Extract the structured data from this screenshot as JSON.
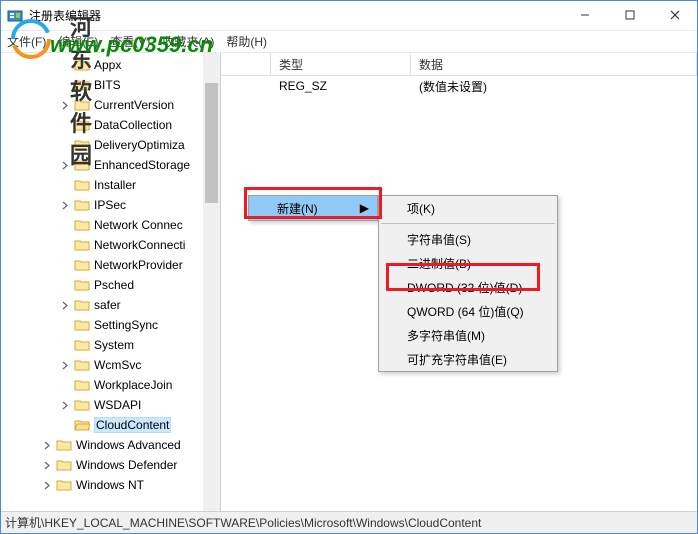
{
  "window": {
    "title": "注册表编辑器"
  },
  "menubar": {
    "file": "文件(F)",
    "edit": "编辑(E)",
    "view": "查看(V)",
    "fav": "收藏夹(A)",
    "help": "帮助(H)"
  },
  "tree": {
    "items": [
      {
        "label": "Appx",
        "indent": 2,
        "exp": false,
        "open": false
      },
      {
        "label": "BITS",
        "indent": 2,
        "exp": false,
        "open": false
      },
      {
        "label": "CurrentVersion",
        "indent": 2,
        "exp": true,
        "open": false
      },
      {
        "label": "DataCollection",
        "indent": 2,
        "exp": false,
        "open": false
      },
      {
        "label": "DeliveryOptimiza",
        "indent": 2,
        "exp": false,
        "open": false
      },
      {
        "label": "EnhancedStorage",
        "indent": 2,
        "exp": true,
        "open": false
      },
      {
        "label": "Installer",
        "indent": 2,
        "exp": false,
        "open": false
      },
      {
        "label": "IPSec",
        "indent": 2,
        "exp": true,
        "open": false
      },
      {
        "label": "Network Connec",
        "indent": 2,
        "exp": false,
        "open": false
      },
      {
        "label": "NetworkConnecti",
        "indent": 2,
        "exp": false,
        "open": false
      },
      {
        "label": "NetworkProvider",
        "indent": 2,
        "exp": false,
        "open": false
      },
      {
        "label": "Psched",
        "indent": 2,
        "exp": false,
        "open": false
      },
      {
        "label": "safer",
        "indent": 2,
        "exp": true,
        "open": false
      },
      {
        "label": "SettingSync",
        "indent": 2,
        "exp": false,
        "open": false
      },
      {
        "label": "System",
        "indent": 2,
        "exp": false,
        "open": false
      },
      {
        "label": "WcmSvc",
        "indent": 2,
        "exp": true,
        "open": false
      },
      {
        "label": "WorkplaceJoin",
        "indent": 2,
        "exp": false,
        "open": false
      },
      {
        "label": "WSDAPI",
        "indent": 2,
        "exp": true,
        "open": false
      },
      {
        "label": "CloudContent",
        "indent": 2,
        "exp": false,
        "open": true,
        "selected": true
      },
      {
        "label": "Windows Advanced",
        "indent": 1,
        "exp": true,
        "open": false
      },
      {
        "label": "Windows Defender",
        "indent": 1,
        "exp": true,
        "open": false
      },
      {
        "label": "Windows NT",
        "indent": 1,
        "exp": true,
        "open": false
      }
    ]
  },
  "list": {
    "headers": {
      "type": "类型",
      "data": "数据"
    },
    "rows": [
      {
        "type": "REG_SZ",
        "data": "(数值未设置)"
      }
    ]
  },
  "context": {
    "new": "新建(N)",
    "sub": {
      "key": "项(K)",
      "string": "字符串值(S)",
      "binary": "二进制值(B)",
      "dword": "DWORD (32 位)值(D)",
      "qword": "QWORD (64 位)值(Q)",
      "multi": "多字符串值(M)",
      "expand": "可扩充字符串值(E)"
    }
  },
  "statusbar": {
    "path": "计算机\\HKEY_LOCAL_MACHINE\\SOFTWARE\\Policies\\Microsoft\\Windows\\CloudContent"
  },
  "watermark": {
    "cn": "河东软件园",
    "url": "www.pc0359.cn"
  }
}
